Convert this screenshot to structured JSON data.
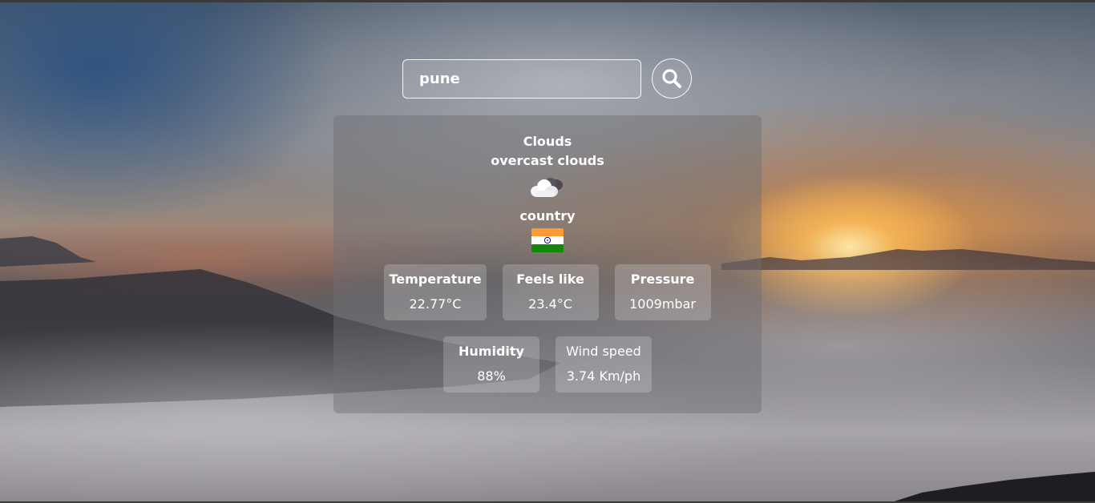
{
  "search": {
    "value": "pune",
    "button_icon": "search-icon"
  },
  "weather": {
    "main": "Clouds",
    "description": "overcast clouds",
    "icon": "cloud-icon",
    "country_label": "country",
    "country_flag": "india-flag-icon"
  },
  "stats": [
    {
      "label": "Temperature",
      "value": "22.77°C"
    },
    {
      "label": "Feels like",
      "value": "23.4°C"
    },
    {
      "label": "Pressure",
      "value": "1009mbar"
    },
    {
      "label": "Humidity",
      "value": "88%"
    },
    {
      "label": "Wind speed",
      "value": "3.74 Km/ph"
    }
  ],
  "colors": {
    "card_bg": "#6e6e73",
    "text": "#ffffff",
    "flag_saffron": "#ff9933",
    "flag_green": "#138808",
    "flag_chakra": "#000080"
  }
}
